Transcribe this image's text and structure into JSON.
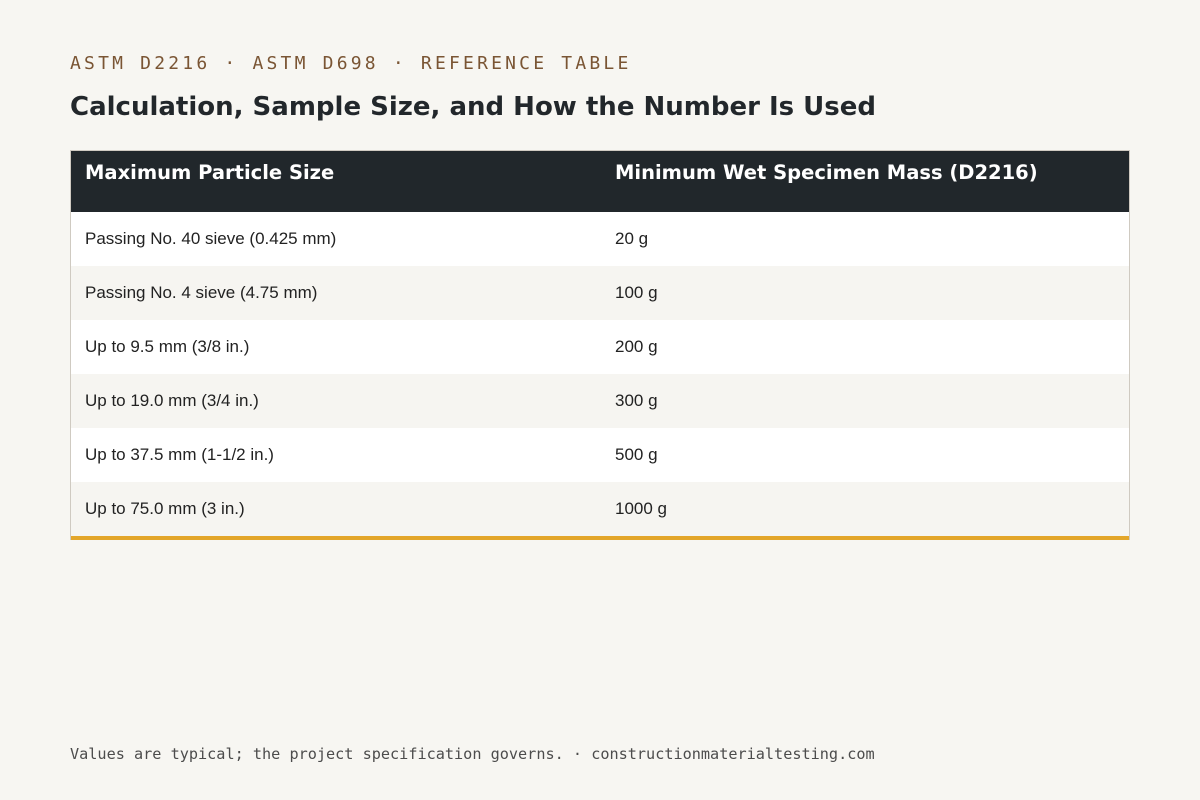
{
  "eyebrow": "ASTM D2216 · ASTM D698 · REFERENCE TABLE",
  "title": "Calculation, Sample Size, and How the Number Is Used",
  "table": {
    "headers": [
      "Maximum Particle Size",
      "Minimum Wet Specimen Mass (D2216)"
    ],
    "rows": [
      [
        "Passing No. 40 sieve (0.425 mm)",
        "20 g"
      ],
      [
        "Passing No. 4 sieve (4.75 mm)",
        "100 g"
      ],
      [
        "Up to 9.5 mm (3/8 in.)",
        "200 g"
      ],
      [
        "Up to 19.0 mm (3/4 in.)",
        "300 g"
      ],
      [
        "Up to 37.5 mm (1-1/2 in.)",
        "500 g"
      ],
      [
        "Up to 75.0 mm (3 in.)",
        "1000 g"
      ]
    ]
  },
  "footer": "Values are typical; the project specification governs. · constructionmaterialtesting.com",
  "colors": {
    "background": "#f7f6f2",
    "header_bg": "#21272b",
    "accent": "#e3a62a",
    "eyebrow": "#7a5534"
  }
}
